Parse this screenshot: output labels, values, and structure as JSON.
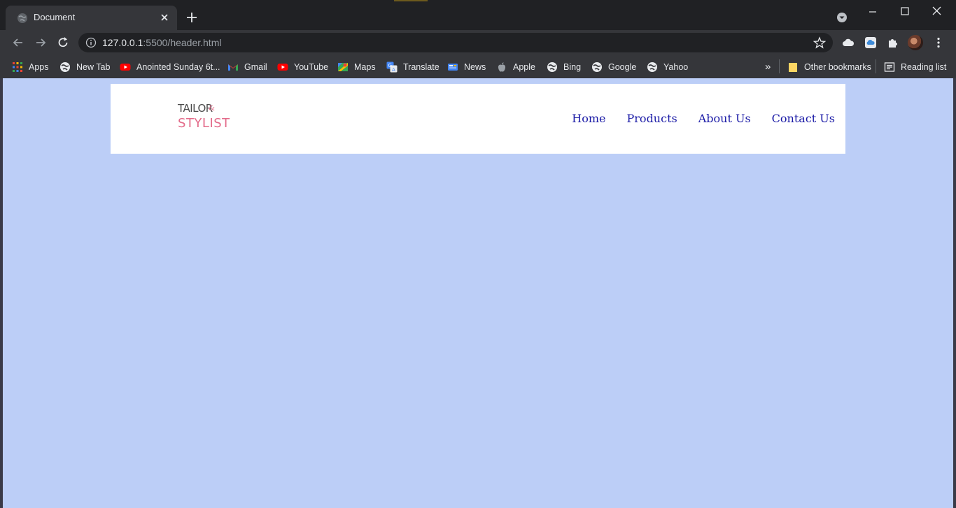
{
  "browser": {
    "tab": {
      "title": "Document"
    },
    "url": {
      "host": "127.0.0.1",
      "rest": ":5500/header.html"
    },
    "bookmarks": [
      {
        "label": "Apps",
        "icon": "apps-grid-icon"
      },
      {
        "label": "New Tab",
        "icon": "globe-icon"
      },
      {
        "label": "Anointed Sunday 6t...",
        "icon": "youtube-icon"
      },
      {
        "label": "Gmail",
        "icon": "gmail-icon"
      },
      {
        "label": "YouTube",
        "icon": "youtube-icon"
      },
      {
        "label": "Maps",
        "icon": "maps-icon"
      },
      {
        "label": "Translate",
        "icon": "translate-icon"
      },
      {
        "label": "News",
        "icon": "news-icon"
      },
      {
        "label": "Apple",
        "icon": "apple-icon"
      },
      {
        "label": "Bing",
        "icon": "globe-icon"
      },
      {
        "label": "Google",
        "icon": "globe-icon"
      },
      {
        "label": "Yahoo",
        "icon": "globe-icon"
      }
    ],
    "overflow_label": "»",
    "other_bookmarks": "Other bookmarks",
    "reading_list": "Reading list"
  },
  "site": {
    "logo": {
      "top": "TAILOR",
      "amp": "&",
      "bottom": "STYLIST"
    },
    "nav": [
      "Home",
      "Products",
      "About Us",
      "Contact Us"
    ]
  },
  "colors": {
    "page_background": "#bccef7",
    "header_background": "#ffffff",
    "nav_link": "#1a1aa6",
    "logo_accent": "#e36b8a"
  }
}
